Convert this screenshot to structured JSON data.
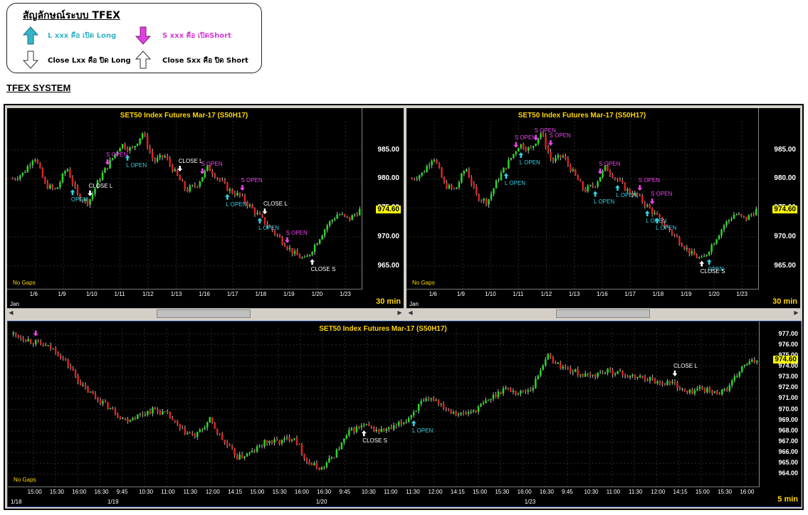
{
  "legend": {
    "title": "สัญลักษณ์ระบบ TFEX",
    "items": [
      {
        "text": "L xxx คือ เปิด Long",
        "color": "#33b5c9",
        "icon": "arrow-up-filled-icon"
      },
      {
        "text": "S xxx คือ เปิดShort",
        "color": "#d43bd4",
        "icon": "arrow-down-filled-icon"
      },
      {
        "text": "Close Lxx คือ ปิด Long",
        "color": "#000000",
        "icon": "arrow-down-outline-icon"
      },
      {
        "text": "Close Sxx คือ ปิด Short",
        "color": "#000000",
        "icon": "arrow-up-outline-icon"
      }
    ]
  },
  "system_title": "TFEX SYSTEM",
  "colors": {
    "up": "#22dd22",
    "down": "#e02020",
    "long": "#33d0e0",
    "short": "#ee44ee",
    "close": "#ffffff"
  },
  "chart_data": [
    {
      "type": "candlestick",
      "title": "SET50  Index  Futures  Mar-17  (S50H17)",
      "interval": "30  min",
      "last_price": "974.60",
      "y_ticks": [
        "985.00",
        "980.00",
        "975.00",
        "970.00",
        "965.00"
      ],
      "ylim": [
        963.0,
        990.0
      ],
      "x_ticks": [
        "1/6",
        "1/9",
        "1/10",
        "1/11",
        "1/12",
        "1/13",
        "1/16",
        "1/17",
        "1/18",
        "1/19",
        "1/20",
        "1/23"
      ],
      "x_sub": "Jan",
      "note": "No  Gaps",
      "path": [
        980,
        981,
        984,
        979,
        978,
        982,
        977,
        976,
        980,
        983,
        986,
        985,
        988,
        983,
        984,
        981,
        978,
        979,
        982,
        980,
        978,
        977,
        975,
        973,
        971,
        969,
        967,
        966,
        969,
        972,
        974,
        973,
        974.6
      ],
      "signals": [
        {
          "label": "OPEN",
          "type": "long",
          "at": 0.17
        },
        {
          "label": "CLOSE  L",
          "type": "close",
          "at": 0.22
        },
        {
          "label": "S  OPEN",
          "type": "short",
          "at": 0.27
        },
        {
          "label": "L  OPEN",
          "type": "long",
          "at": 0.33
        },
        {
          "label": "CLOSE  L",
          "type": "close",
          "at": 0.48
        },
        {
          "label": "S  OPEN",
          "type": "short",
          "at": 0.55
        },
        {
          "label": "L  OPEN",
          "type": "long",
          "at": 0.62
        },
        {
          "label": "S  OPEN",
          "type": "short",
          "at": 0.66
        },
        {
          "label": "L  OPEN",
          "type": "long",
          "at": 0.71
        },
        {
          "label": "CLOSE  L",
          "type": "close",
          "at": 0.73
        },
        {
          "label": "S  OPEN",
          "type": "short",
          "at": 0.79
        },
        {
          "label": "CLOSE  S",
          "type": "close-up",
          "at": 0.86
        }
      ]
    },
    {
      "type": "candlestick",
      "title": "SET50  Index  Futures  Mar-17  (S50H17)",
      "interval": "30  min",
      "last_price": "974.60",
      "y_ticks": [
        "985.00",
        "980.00",
        "975.00",
        "970.00",
        "965.00"
      ],
      "ylim": [
        963.0,
        990.0
      ],
      "x_ticks": [
        "1/6",
        "1/9",
        "1/10",
        "1/11",
        "1/12",
        "1/13",
        "1/16",
        "1/17",
        "1/18",
        "1/19",
        "1/20",
        "1/23"
      ],
      "x_sub": "Jan",
      "note": "No  Gaps",
      "path": [
        980,
        981,
        984,
        979,
        978,
        982,
        977,
        976,
        980,
        983,
        986,
        985,
        988,
        983,
        984,
        981,
        978,
        979,
        982,
        980,
        978,
        977,
        975,
        973,
        971,
        969,
        967,
        966,
        969,
        972,
        974,
        973,
        974.6
      ],
      "signals": [
        {
          "label": "S  OPEN",
          "type": "short",
          "at": 0.3
        },
        {
          "label": "L  OPEN",
          "type": "long",
          "at": 0.27
        },
        {
          "label": "S  OPEN",
          "type": "short",
          "at": 0.36
        },
        {
          "label": "L  OPEN",
          "type": "long",
          "at": 0.32
        },
        {
          "label": "S  OPEN",
          "type": "short",
          "at": 0.4
        },
        {
          "label": "S  OPEN",
          "type": "short",
          "at": 0.55
        },
        {
          "label": "L  OPEN",
          "type": "long",
          "at": 0.53
        },
        {
          "label": "L  OPEN",
          "type": "long",
          "at": 0.6
        },
        {
          "label": "S  OPEN",
          "type": "short",
          "at": 0.66
        },
        {
          "label": "L  OPEN",
          "type": "long",
          "at": 0.68
        },
        {
          "label": "S  OPEN",
          "type": "short",
          "at": 0.7
        },
        {
          "label": "L  OPEN",
          "type": "long",
          "at": 0.71
        },
        {
          "label": "OPEN",
          "type": "long",
          "at": 0.86
        },
        {
          "label": "CLOSE S",
          "type": "close-up",
          "at": 0.84
        }
      ]
    },
    {
      "type": "candlestick",
      "title": "SET50  Index  Futures  Mar-17  (S50H17)",
      "interval": "5  min",
      "last_price": "974.60",
      "y_ticks": [
        "977.00",
        "976.00",
        "975.00",
        "974.00",
        "973.00",
        "972.00",
        "971.00",
        "970.00",
        "969.00",
        "968.00",
        "967.00",
        "966.00",
        "965.00",
        "964.00"
      ],
      "ylim": [
        963.5,
        977.5
      ],
      "x_ticks": [
        "15:00",
        "15:30",
        "16:00",
        "16:30",
        "9:45",
        "10:30",
        "11:00",
        "11:30",
        "12:00",
        "14:15",
        "15:00",
        "15:30",
        "16:00",
        "16:30",
        "9:45",
        "10:30",
        "11:00",
        "11:30",
        "12:00",
        "14:15",
        "15:00",
        "15:30",
        "16:00",
        "16:30",
        "9:45",
        "10:30",
        "11:00",
        "11:30",
        "12:00",
        "14:15",
        "15:00",
        "15:30",
        "16:00"
      ],
      "x_dates": [
        "1/18",
        "1/19",
        "1/20",
        "1/23"
      ],
      "note": "No  Gaps",
      "path": [
        977,
        976.5,
        976,
        975.5,
        974,
        972,
        971,
        970,
        969,
        969.5,
        970,
        969.5,
        968,
        967.5,
        969,
        967,
        965.5,
        966,
        967,
        967,
        967.5,
        965,
        964.5,
        966,
        968,
        968.5,
        968,
        968.2,
        969,
        970.5,
        971,
        970,
        969.5,
        970,
        971,
        972,
        971.5,
        972,
        975,
        974,
        973.5,
        973,
        973.5,
        973.5,
        973,
        973,
        972.5,
        972.5,
        971.5,
        972,
        971.5,
        972,
        974,
        974.6
      ],
      "signals": [
        {
          "label": "",
          "type": "short",
          "at": 0.03
        },
        {
          "label": "CLOSE  S",
          "type": "close-up",
          "at": 0.47
        },
        {
          "label": "L  OPEN",
          "type": "long",
          "at": 0.54
        },
        {
          "label": "CLOSE  L",
          "type": "close",
          "at": 0.89
        }
      ]
    }
  ]
}
